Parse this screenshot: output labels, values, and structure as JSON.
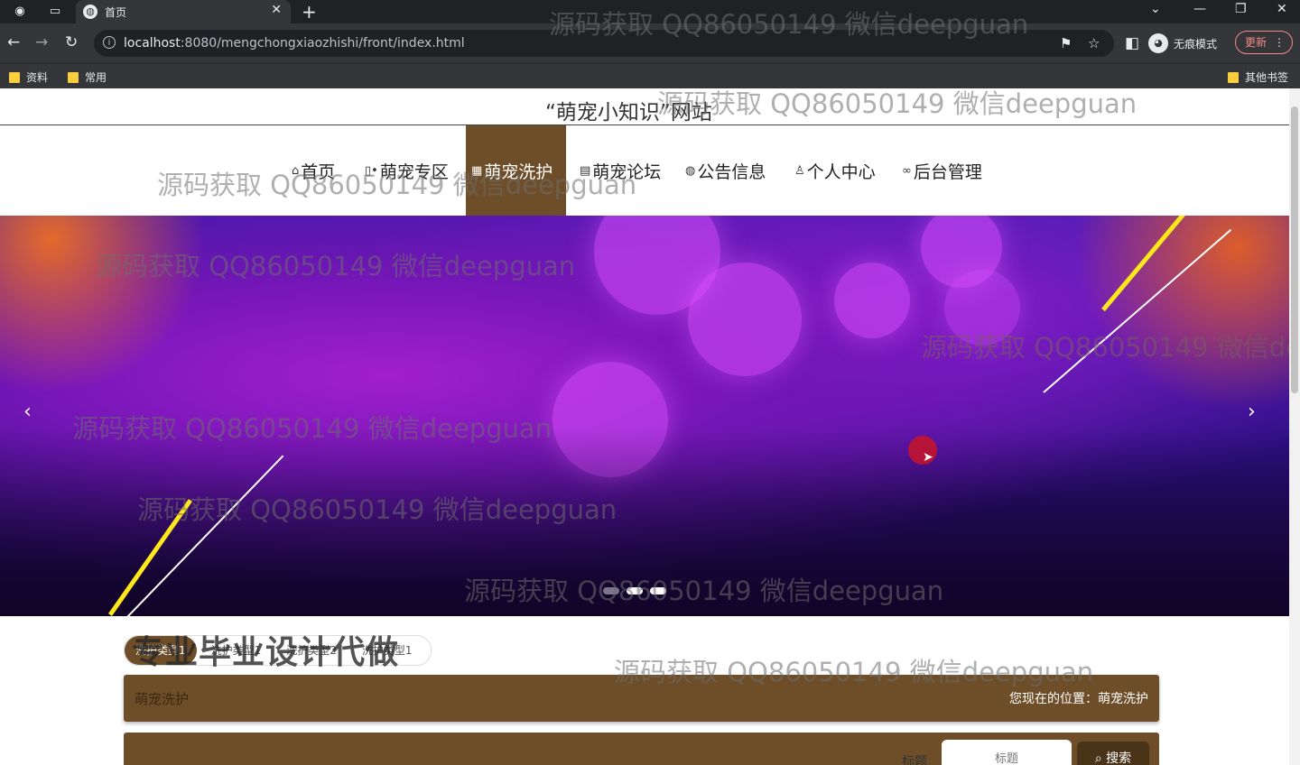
{
  "browser": {
    "tab_title": "首页",
    "url_host": "localhost",
    "url_rest": ":8080/mengchongxiaozhishi/front/index.html",
    "incognito_label": "无痕模式",
    "update_label": "更新",
    "bookmarks": [
      "资料",
      "常用"
    ],
    "other_bookmarks": "其他书签"
  },
  "site": {
    "title": "“萌宠小知识”网站"
  },
  "nav": [
    {
      "label": "首页",
      "icon": "home-icon"
    },
    {
      "label": "萌宠专区",
      "icon": "pet-icon"
    },
    {
      "label": "萌宠洗护",
      "icon": "care-icon",
      "active": true
    },
    {
      "label": "萌宠论坛",
      "icon": "forum-icon"
    },
    {
      "label": "公告信息",
      "icon": "globe-icon"
    },
    {
      "label": "个人中心",
      "icon": "user-icon"
    },
    {
      "label": "后台管理",
      "icon": "link-icon"
    }
  ],
  "carousel": {
    "prev": "‹",
    "next": "›",
    "slides": 3,
    "active_slide": 1
  },
  "subtabs": [
    "洗护类型1",
    "洗护类型1",
    "洗护类型2",
    "洗护类型1"
  ],
  "promo_text": "专业毕业设计代做",
  "crumb": {
    "title": "萌宠洗护",
    "location": "您现在的位置：萌宠洗护"
  },
  "search": {
    "label": "标题",
    "placeholder": "标题",
    "button": "搜索"
  },
  "watermark": "源码获取 QQ86050149 微信deepguan",
  "colors": {
    "accent": "#6e4e28",
    "accent_dark": "#4a3418",
    "chrome_bg": "#35363a"
  }
}
